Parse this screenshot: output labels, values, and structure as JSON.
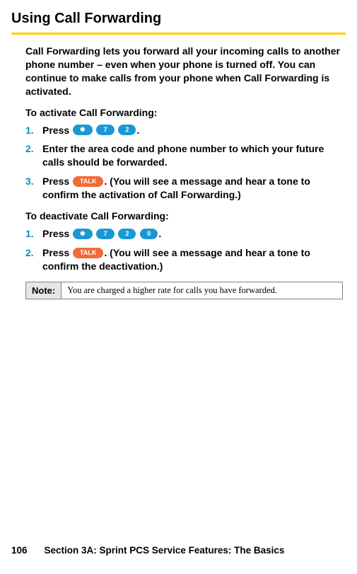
{
  "title": "Using Call Forwarding",
  "intro": "Call Forwarding lets you forward all your incoming calls to another phone number – even when your phone is turned off. You can continue to make calls from your phone when Call Forwarding is activated.",
  "activate": {
    "heading": "To activate Call Forwarding:",
    "steps": [
      {
        "num": "1.",
        "pre": "Press ",
        "keys": [
          "✱",
          "7",
          "2"
        ],
        "post": "."
      },
      {
        "num": "2.",
        "text": "Enter the area code and phone number to which your future calls should be forwarded."
      },
      {
        "num": "3.",
        "pre": "Press ",
        "keys": [
          "TALK"
        ],
        "post": ". (You will see a message and hear a tone to confirm the activation of Call Forwarding.)"
      }
    ]
  },
  "deactivate": {
    "heading": "To deactivate Call Forwarding:",
    "steps": [
      {
        "num": "1.",
        "pre": "Press ",
        "keys": [
          "✱",
          "7",
          "2",
          "0"
        ],
        "post": "."
      },
      {
        "num": "2.",
        "pre": "Press ",
        "keys": [
          "TALK"
        ],
        "post": ". (You will see a message and hear a tone to confirm the deactivation.)"
      }
    ]
  },
  "note": {
    "label": "Note:",
    "text": "You are charged a higher rate for calls you have forwarded."
  },
  "footer": {
    "page_number": "106",
    "section": "Section 3A: Sprint PCS Service Features: The Basics"
  }
}
